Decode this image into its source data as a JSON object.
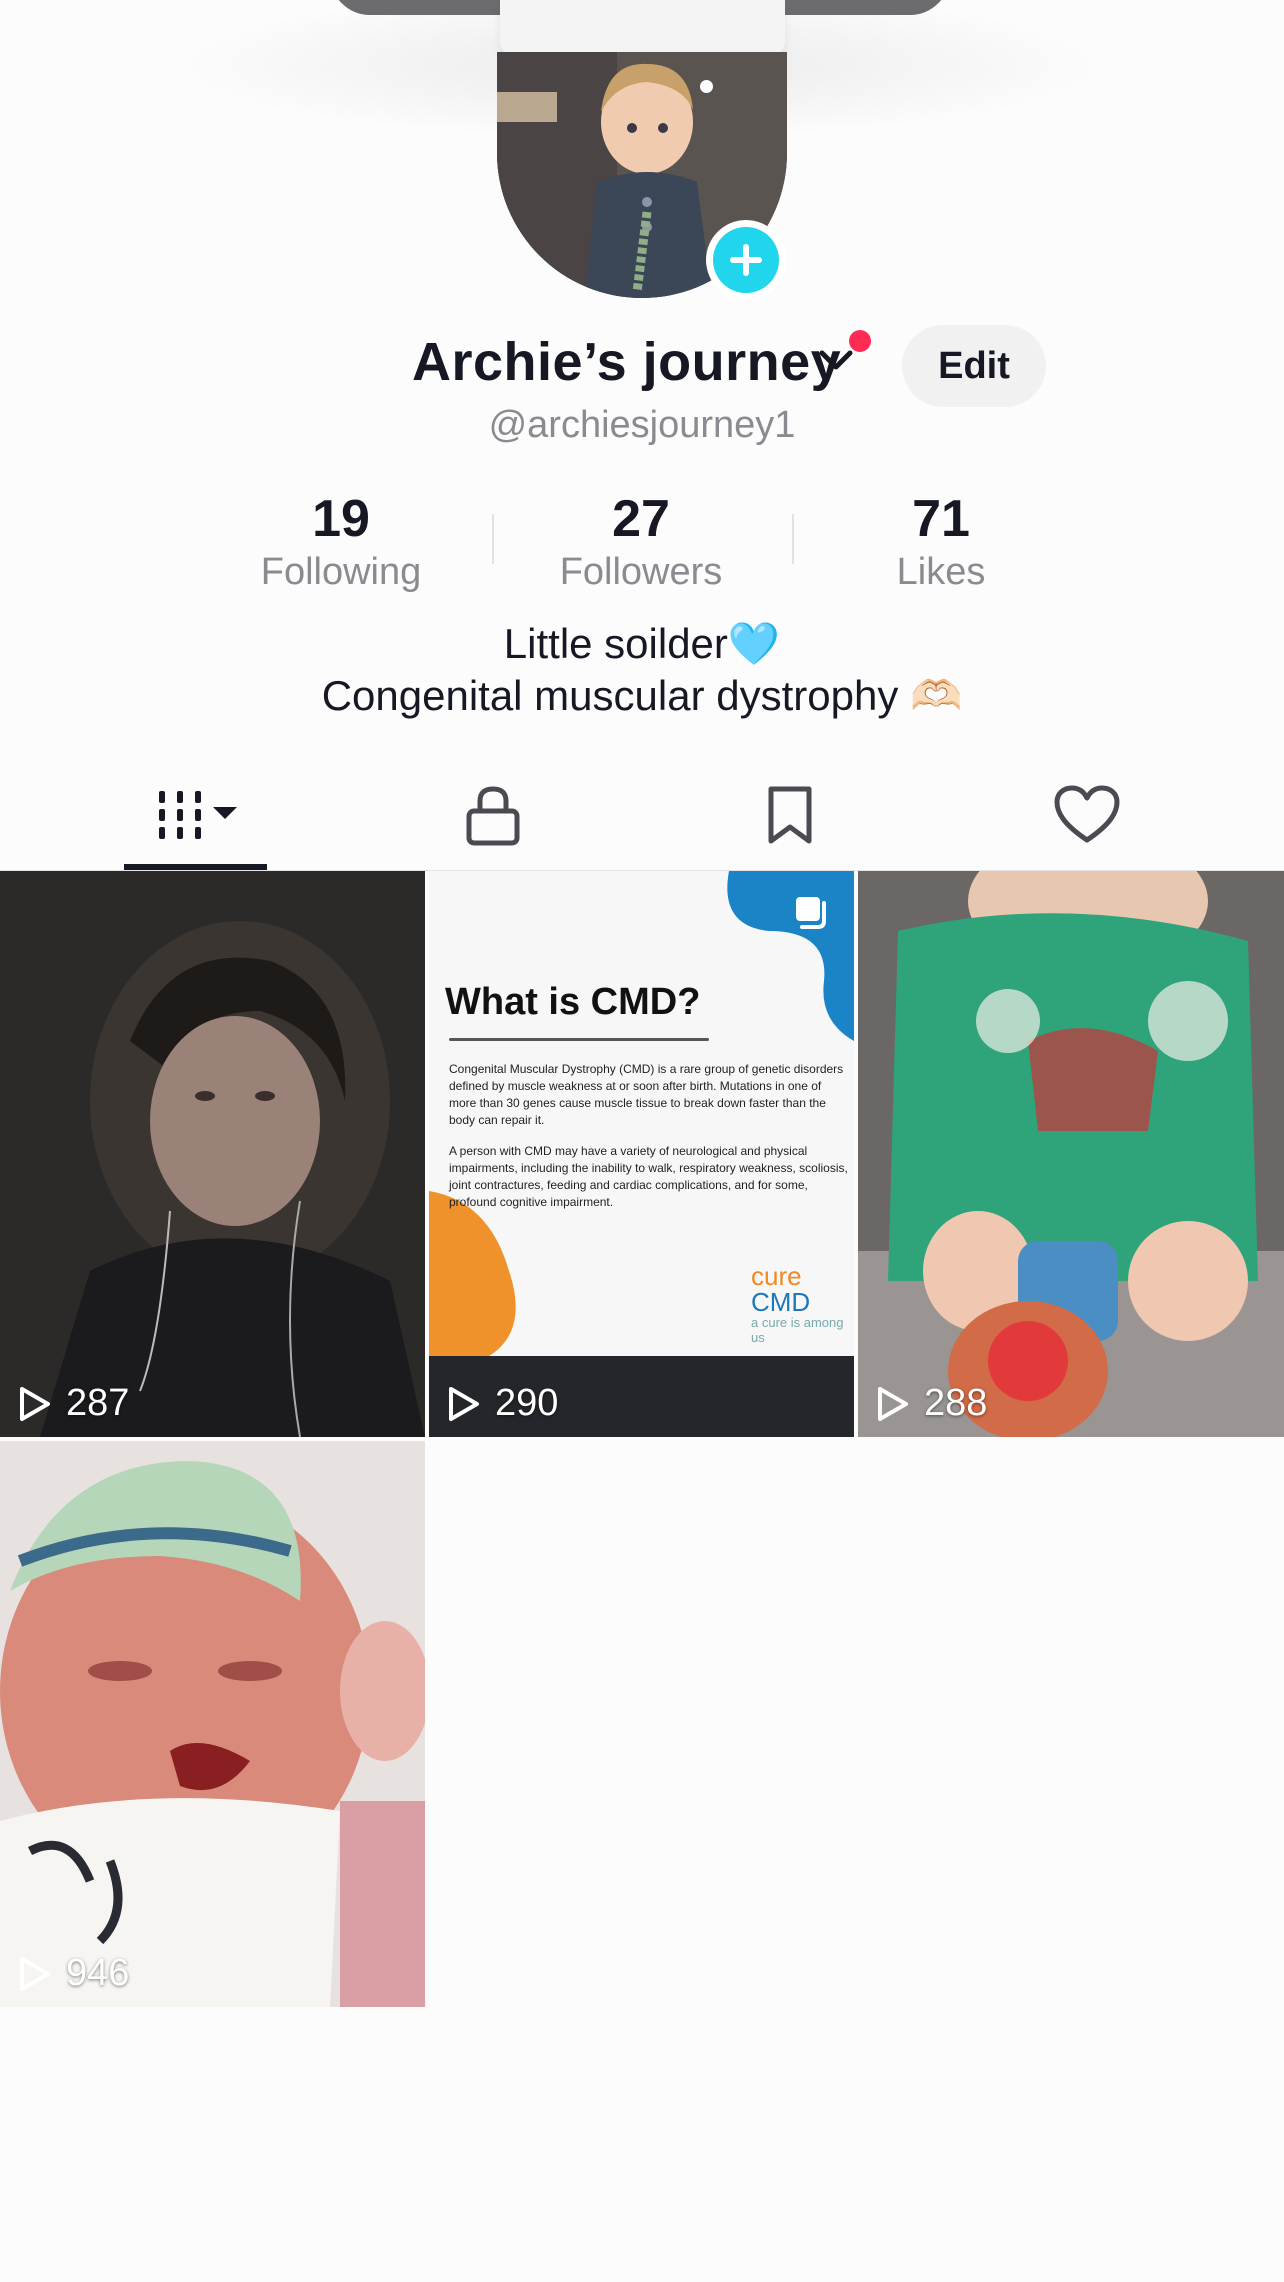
{
  "profile": {
    "name": "Archie’s journey",
    "handle": "@archiesjourney1",
    "edit_label": "Edit",
    "stats": [
      {
        "value": "19",
        "label": "Following"
      },
      {
        "value": "27",
        "label": "Followers"
      },
      {
        "value": "71",
        "label": "Likes"
      }
    ],
    "bio_line1": "Little soilder🩵",
    "bio_line2": "Congenital muscular dystrophy 🫶🏻"
  },
  "tabs": [
    {
      "name": "videos",
      "icon": "grid-icon"
    },
    {
      "name": "private",
      "icon": "lock-icon"
    },
    {
      "name": "favorites",
      "icon": "bookmark-icon"
    },
    {
      "name": "liked",
      "icon": "heart-icon"
    }
  ],
  "videos": [
    {
      "views": "287",
      "thumb": "woman-selfie"
    },
    {
      "views": "290",
      "thumb": "what-is-cmd",
      "title": "What is CMD?",
      "para1": "Congenital Muscular Dystrophy (CMD) is a rare group of genetic disorders defined by muscle weakness at or soon after birth. Mutations in one of more than 30 genes cause muscle tissue to break down faster than the body can repair it.",
      "para2": "A person with CMD may have a variety of neurological and physical impairments, including the inability to walk, respiratory weakness, scoliosis, joint contractures, feeding and cardiac complications, and for some, profound cognitive impairment.",
      "logo_cure": "cure",
      "logo_cmd": "CMD",
      "logo_tag": "a cure is among us"
    },
    {
      "views": "288",
      "thumb": "child-mickey-sweater"
    },
    {
      "views": "946",
      "thumb": "newborn-crying"
    }
  ],
  "colors": {
    "accent": "#fe2c55",
    "add_badge": "#20d5ec",
    "text": "#161823",
    "muted": "#8a8b91"
  }
}
